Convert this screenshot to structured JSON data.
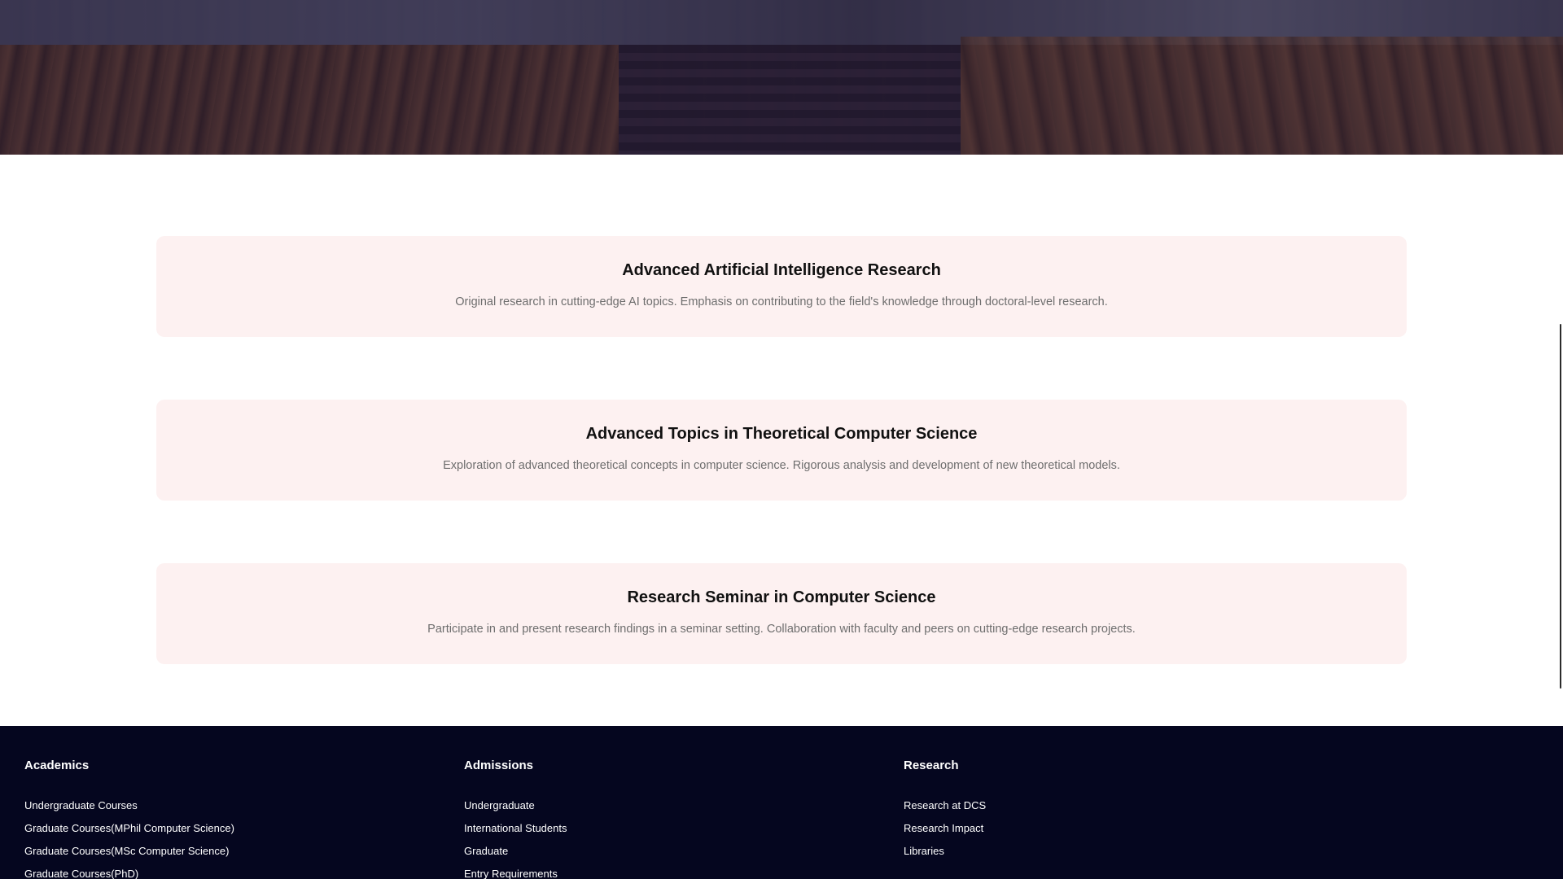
{
  "hero": {
    "image_description_icon": "campus-photo-banner"
  },
  "courses": [
    {
      "title": "Advanced Artificial Intelligence Research",
      "description": "Original research in cutting-edge AI topics. Emphasis on contributing to the field's knowledge through doctoral-level research."
    },
    {
      "title": "Advanced Topics in Theoretical Computer Science",
      "description": "Exploration of advanced theoretical concepts in computer science. Rigorous analysis and development of new theoretical models."
    },
    {
      "title": "Research Seminar in Computer Science",
      "description": "Participate in and present research findings in a seminar setting. Collaboration with faculty and peers on cutting-edge research projects."
    }
  ],
  "footer": {
    "columns": [
      {
        "heading": "Academics",
        "links": [
          "Undergraduate Courses",
          "Graduate Courses(MPhil Computer Science)",
          "Graduate Courses(MSc Computer Science)",
          "Graduate Courses(PhD)"
        ]
      },
      {
        "heading": "Admissions",
        "links": [
          "Undergraduate",
          "International Students",
          "Graduate",
          "Entry Requirements"
        ]
      },
      {
        "heading": "Research",
        "links": [
          "Research at DCS",
          "Research Impact",
          "Libraries"
        ]
      }
    ]
  },
  "colors": {
    "card_background": "#fdf1f1",
    "footer_background": "#05061f",
    "title_text": "#111111",
    "description_text": "#6e6e6e"
  }
}
